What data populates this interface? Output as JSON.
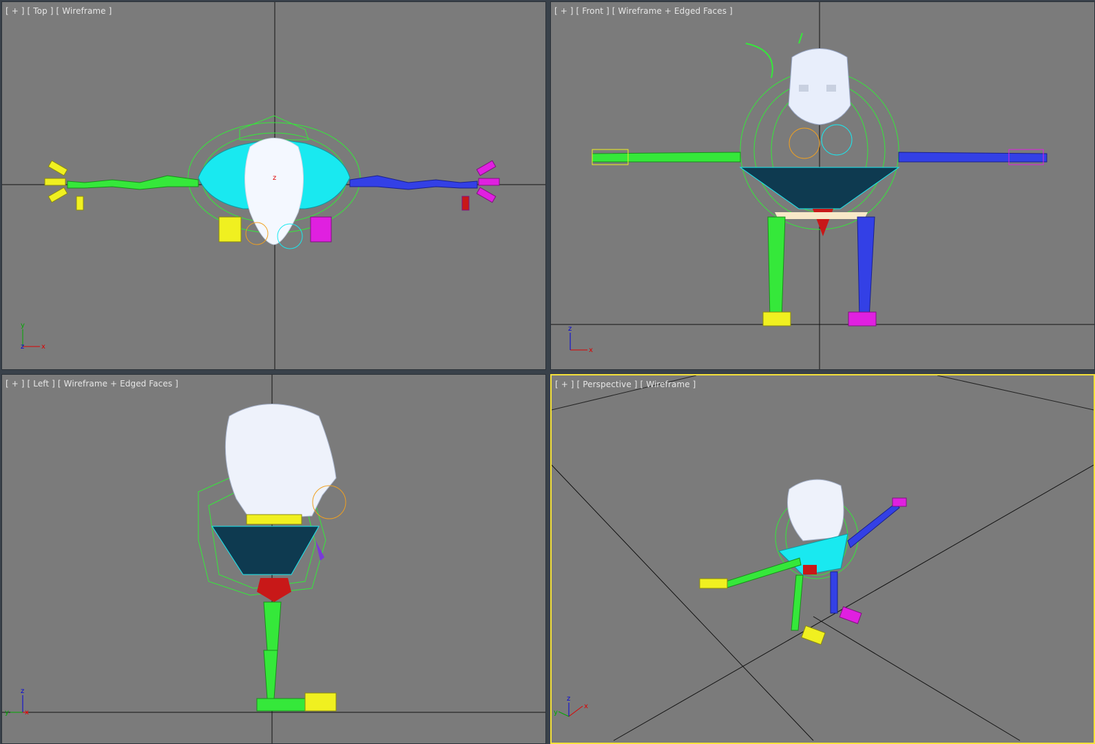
{
  "viewports": {
    "top": {
      "menu": "[ + ]",
      "view": "[ Top ]",
      "shading": "[ Wireframe ]"
    },
    "front": {
      "menu": "[ + ]",
      "view": "[ Front ]",
      "shading": "[ Wireframe + Edged Faces ]"
    },
    "left": {
      "menu": "[ + ]",
      "view": "[ Left ]",
      "shading": "[ Wireframe + Edged Faces ]"
    },
    "persp": {
      "menu": "[ + ]",
      "view": "[ Perspective ]",
      "shading": "[ Wireframe ]"
    }
  },
  "axes": {
    "x": "x",
    "y": "y",
    "z": "z"
  },
  "colors": {
    "viewport_bg": "#7b7b7b",
    "active_border": "#f6e23b",
    "rig_green": "#35e83a",
    "rig_blue": "#3340e6",
    "rig_cyan": "#19e9f0",
    "rig_magenta": "#e020e0",
    "rig_yellow": "#f0f020",
    "head_white": "#f4f8ff",
    "pelvis_red": "#c81818"
  }
}
